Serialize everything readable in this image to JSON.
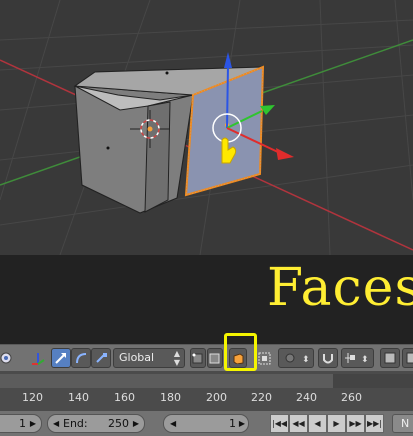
{
  "overlay": {
    "caption": "Faces"
  },
  "header": {
    "orientation_value": "Global",
    "icons": {
      "pivot": "pivot-icon",
      "manipulator": "manipulator-icon",
      "translate": "translate-arrow-icon",
      "rotate": "rotate-icon",
      "scale": "scale-icon",
      "vertex_select": "vertex-select-icon",
      "edge_select": "edge-select-icon",
      "face_select": "face-select-icon",
      "occlude": "limit-selection-icon",
      "proportional": "proportional-edit-icon",
      "snap": "snap-magnet-icon",
      "snap_target": "snap-target-icon"
    }
  },
  "timeline": {
    "ticks": [
      "120",
      "140",
      "160",
      "180",
      "200",
      "220",
      "240",
      "260"
    ]
  },
  "footer": {
    "start_value": "1",
    "end_label": "End:",
    "end_value": "250",
    "current_frame": "1",
    "label_partial": "N"
  },
  "colors": {
    "viewport_bg": "#393939",
    "highlight": "#f5f500",
    "caption": "#ffee33",
    "face_select_active": "#f7a23b",
    "grid_red": "#b0343d",
    "grid_green": "#3f8c3a"
  }
}
